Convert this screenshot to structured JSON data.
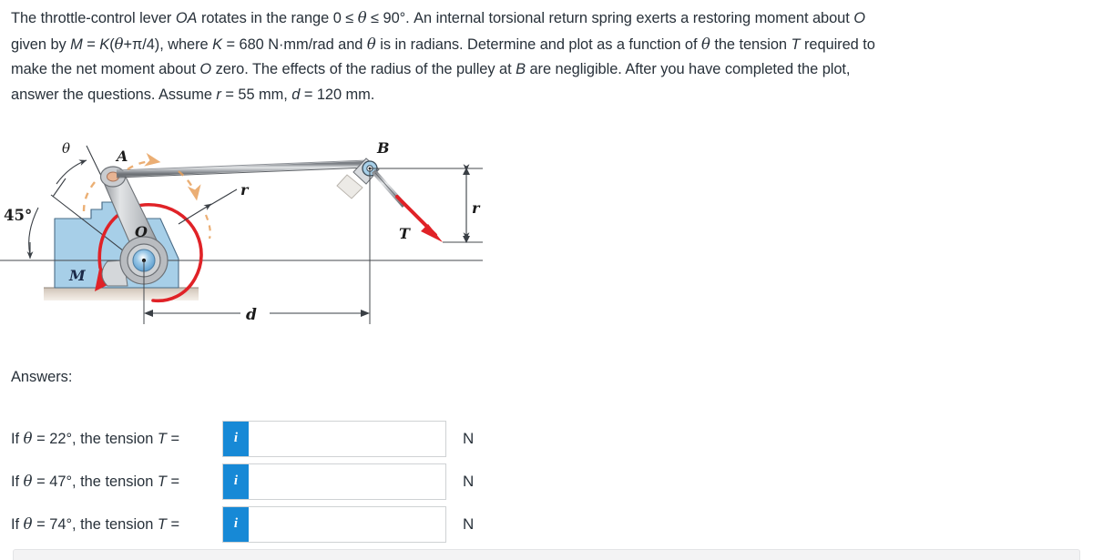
{
  "problem": {
    "line1_a": "The throttle-control lever ",
    "line1_oa": "OA",
    "line1_b": " rotates in the range 0 ≤ ",
    "line1_theta": "θ",
    "line1_c": " ≤ 90°. An internal torsional return spring exerts a restoring moment about ",
    "line1_o": "O",
    "line2_a": "given by ",
    "line2_m": "M",
    "line2_b": " = ",
    "line2_k": "K",
    "line2_c": "(",
    "line2_theta": "θ",
    "line2_d": "+π/4), where ",
    "line2_k2": "K",
    "line2_e": " = 680 N·mm/rad and ",
    "line2_theta2": "θ",
    "line2_f": " is in radians. Determine and plot as a function of ",
    "line2_theta3": "θ",
    "line2_g": " the tension ",
    "line2_t": "T",
    "line2_h": " required to",
    "line3_a": "make the net moment about ",
    "line3_o": "O",
    "line3_b": " zero. The effects of the radius of the pulley at ",
    "line3_bb": "B",
    "line3_c": " are negligible. After you have completed the plot,",
    "line4_a": "answer the questions. Assume ",
    "line4_r": "r",
    "line4_b": " = 55 mm, ",
    "line4_d": "d",
    "line4_c": " = 120 mm."
  },
  "figure": {
    "label_theta": "θ",
    "label_45": "45°",
    "label_A": "A",
    "label_B": "B",
    "label_O": "O",
    "label_M": "M",
    "label_T": "T",
    "label_r_mid": "r",
    "label_r_right": "r",
    "label_d": "d",
    "colors": {
      "bracket_blue": "#a7cfe8",
      "moment_red": "#e02227",
      "tension_red": "#e02227",
      "lever_gray": "#b9bcc0",
      "ground_tan": "#ddd3c8",
      "spring_orange": "#e8a15c"
    }
  },
  "answers": {
    "heading": "Answers:",
    "rows": [
      {
        "prefix": "If ",
        "theta": "θ",
        "mid": " = 22°, the tension ",
        "tvar": "T",
        "suffix": " =",
        "value": "",
        "placeholder": "",
        "info_label": "i",
        "unit": "N"
      },
      {
        "prefix": "If ",
        "theta": "θ",
        "mid": " = 47°, the tension ",
        "tvar": "T",
        "suffix": " =",
        "value": "",
        "placeholder": "",
        "info_label": "i",
        "unit": "N"
      },
      {
        "prefix": "If ",
        "theta": "θ",
        "mid": " = 74°, the tension ",
        "tvar": "T",
        "suffix": " =",
        "value": "",
        "placeholder": "",
        "info_label": "i",
        "unit": "N"
      }
    ]
  }
}
